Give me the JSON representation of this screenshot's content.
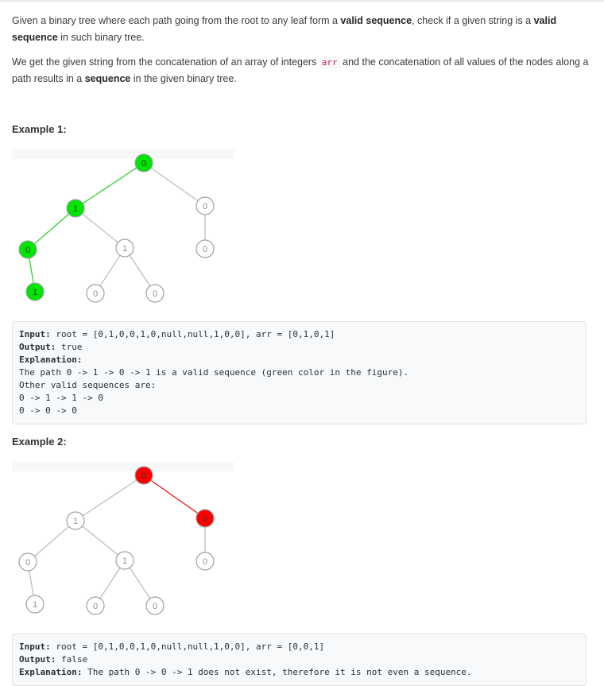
{
  "intro": {
    "p1": [
      {
        "t": "Given a binary tree where each path going from the root to any leaf form a "
      },
      {
        "t": "valid sequence",
        "b": true
      },
      {
        "t": ", check if a given string is a "
      },
      {
        "t": "valid sequence",
        "b": true
      },
      {
        "t": " in such binary tree."
      }
    ],
    "p2": [
      {
        "t": "We get the given string from the concatenation of an array of integers "
      },
      {
        "t": "arr",
        "code": true
      },
      {
        "t": " and the concatenation of all values of the nodes along a path results in a "
      },
      {
        "t": "sequence",
        "b": true
      },
      {
        "t": " in the given binary tree."
      }
    ]
  },
  "colors": {
    "green_node": "#00e600",
    "green_edge": "#2fd12f",
    "red_node": "#ff0000",
    "red_edge": "#e01818",
    "gray_edge": "#b8c0c4",
    "gray_node_stroke": "#9aa3a8"
  },
  "examples": [
    {
      "title": "Example 1:",
      "tree": {
        "nodes": [
          {
            "id": "a",
            "label": "0",
            "hl": "green"
          },
          {
            "id": "b",
            "label": "1",
            "hl": "green"
          },
          {
            "id": "c",
            "label": "0",
            "hl": ""
          },
          {
            "id": "d",
            "label": "0",
            "hl": "green"
          },
          {
            "id": "e",
            "label": "1",
            "hl": ""
          },
          {
            "id": "f",
            "label": "0",
            "hl": ""
          },
          {
            "id": "g",
            "label": "1",
            "hl": "green"
          },
          {
            "id": "h",
            "label": "0",
            "hl": ""
          },
          {
            "id": "i",
            "label": "0",
            "hl": ""
          }
        ],
        "edges": [
          {
            "from": "a",
            "to": "b",
            "hl": "green"
          },
          {
            "from": "a",
            "to": "c",
            "hl": ""
          },
          {
            "from": "b",
            "to": "d",
            "hl": "green"
          },
          {
            "from": "b",
            "to": "e",
            "hl": ""
          },
          {
            "from": "c",
            "to": "f",
            "hl": ""
          },
          {
            "from": "d",
            "to": "g",
            "hl": "green"
          },
          {
            "from": "e",
            "to": "h",
            "hl": ""
          },
          {
            "from": "e",
            "to": "i",
            "hl": ""
          }
        ]
      },
      "lines": [
        [
          {
            "t": "Input:",
            "b": true
          },
          {
            "t": " root = [0,1,0,0,1,0,null,null,1,0,0], arr = [0,1,0,1]"
          }
        ],
        [
          {
            "t": "Output:",
            "b": true
          },
          {
            "t": " true"
          }
        ],
        [
          {
            "t": "Explanation:",
            "b": true
          }
        ],
        [
          {
            "t": "The path 0 -> 1 -> 0 -> 1 is a valid sequence (green color in the figure)."
          }
        ],
        [
          {
            "t": "Other valid sequences are:"
          }
        ],
        [
          {
            "t": "0 -> 1 -> 1 -> 0"
          }
        ],
        [
          {
            "t": "0 -> 0 -> 0"
          }
        ]
      ]
    },
    {
      "title": "Example 2:",
      "tree": {
        "nodes": [
          {
            "id": "a",
            "label": "0",
            "hl": "red"
          },
          {
            "id": "b",
            "label": "1",
            "hl": ""
          },
          {
            "id": "c",
            "label": "0",
            "hl": "red"
          },
          {
            "id": "d",
            "label": "0",
            "hl": ""
          },
          {
            "id": "e",
            "label": "1",
            "hl": ""
          },
          {
            "id": "f",
            "label": "0",
            "hl": ""
          },
          {
            "id": "g",
            "label": "1",
            "hl": ""
          },
          {
            "id": "h",
            "label": "0",
            "hl": ""
          },
          {
            "id": "i",
            "label": "0",
            "hl": ""
          }
        ],
        "edges": [
          {
            "from": "a",
            "to": "b",
            "hl": ""
          },
          {
            "from": "a",
            "to": "c",
            "hl": "red"
          },
          {
            "from": "b",
            "to": "d",
            "hl": ""
          },
          {
            "from": "b",
            "to": "e",
            "hl": ""
          },
          {
            "from": "c",
            "to": "f",
            "hl": ""
          },
          {
            "from": "d",
            "to": "g",
            "hl": ""
          },
          {
            "from": "e",
            "to": "h",
            "hl": ""
          },
          {
            "from": "e",
            "to": "i",
            "hl": ""
          }
        ]
      },
      "lines": [
        [
          {
            "t": "Input:",
            "b": true
          },
          {
            "t": " root = [0,1,0,0,1,0,null,null,1,0,0], arr = [0,0,1]"
          }
        ],
        [
          {
            "t": "Output:",
            "b": true
          },
          {
            "t": " false"
          }
        ],
        [
          {
            "t": "Explanation:",
            "b": true
          },
          {
            "t": " The path 0 -> 0 -> 1 does not exist, therefore it is not even a sequence."
          }
        ]
      ]
    }
  ]
}
